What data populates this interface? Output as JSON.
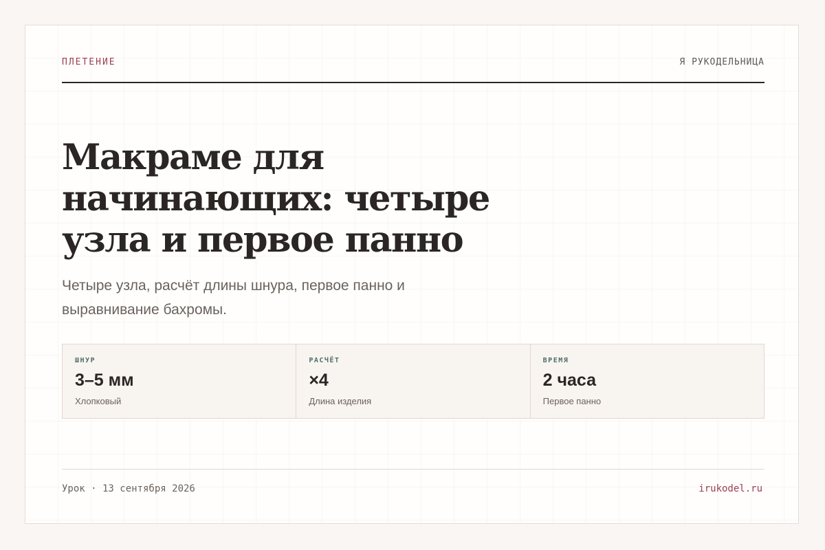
{
  "header": {
    "kicker": "ПЛЕТЕНИЕ",
    "brand": "Я РУКОДЕЛЬНИЦА"
  },
  "article": {
    "title": "Макраме для начинающих: четыре узла и первое панно",
    "lede": "Четыре узла, расчёт длины шнура, первое панно и выравнивание бахромы."
  },
  "stats": [
    {
      "label": "ШНУР",
      "value": "3–5 мм",
      "note": "Хлопковый"
    },
    {
      "label": "РАСЧЁТ",
      "value": "×4",
      "note": "Длина изделия"
    },
    {
      "label": "ВРЕМЯ",
      "value": "2 часа",
      "note": "Первое панно"
    }
  ],
  "footer": {
    "meta": "Урок · 13 сентября 2026",
    "site": "irukodel.ru"
  },
  "colors": {
    "accent": "#9a3f4f",
    "ink": "#2b2624",
    "muted": "#6b625c",
    "label_teal": "#4f6f6a",
    "background": "#f9f6f3"
  }
}
